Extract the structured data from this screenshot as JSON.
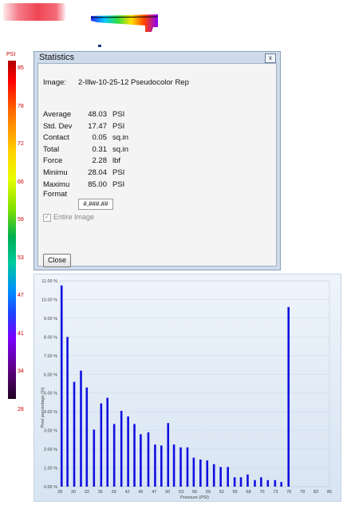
{
  "thumbnails": {
    "left_icon": "pressure-footprint-red-thumbnail",
    "right_icon": "pressure-footprint-pseudocolor-thumbnail"
  },
  "color_scale": {
    "unit": "PSI",
    "ticks": [
      "85",
      "78",
      "72",
      "66",
      "59",
      "53",
      "47",
      "41",
      "34",
      "28"
    ]
  },
  "statistics": {
    "title": "Statistics",
    "close_glyph": "x",
    "image_label": "Image:",
    "image_name": "2-Illw-10-25-12 Pseudocolor Rep",
    "rows": [
      {
        "label": "Average",
        "value": "48.03",
        "unit": "PSI"
      },
      {
        "label": "Std. Dev",
        "value": "17.47",
        "unit": "PSI"
      },
      {
        "label": "Contact",
        "value": "0.05",
        "unit": "sq.in"
      },
      {
        "label": "Total",
        "value": "0.31",
        "unit": "sq.in"
      },
      {
        "label": "Force",
        "value": "2.28",
        "unit": "lbf"
      },
      {
        "label": "Minimu",
        "value": "28.04",
        "unit": "PSI"
      },
      {
        "label": "Maximu",
        "value": "85.00",
        "unit": "PSI"
      }
    ],
    "format_label": "Format",
    "format_value": "#,###.##",
    "entire_image_label": "Entire Image",
    "entire_image_checked": true,
    "close_button": "Close"
  },
  "chart_data": {
    "type": "bar",
    "color": "#1010e0",
    "xlabel": "Pressure (PSI)",
    "ylabel": "Pixel percentage (%)",
    "xlim": [
      28,
      88
    ],
    "ylim": [
      0,
      11
    ],
    "x_ticks": [
      "28",
      "30",
      "33",
      "36",
      "39",
      "42",
      "45",
      "47",
      "50",
      "53",
      "56",
      "59",
      "62",
      "65",
      "68",
      "70",
      "73",
      "76",
      "79",
      "82",
      "85"
    ],
    "y_ticks": [
      "0.00 %",
      "1.00 %",
      "2.00 %",
      "3.00 %",
      "4.00 %",
      "5.00 %",
      "6.00 %",
      "7.00 %",
      "8.00 %",
      "9.00 %",
      "10.00 %",
      "11.00 %"
    ],
    "x": [
      28.4,
      29.7,
      31.2,
      32.7,
      34.0,
      35.6,
      37.2,
      38.6,
      40.1,
      41.7,
      43.2,
      44.6,
      46.0,
      47.7,
      49.2,
      50.6,
      52.1,
      53.4,
      54.9,
      56.4,
      57.8,
      59.3,
      60.8,
      62.3,
      63.8,
      65.4,
      66.9,
      68.3,
      69.8,
      71.4,
      72.8,
      74.3,
      75.9,
      77.3,
      78.9,
      80.4,
      81.9,
      83.5
    ],
    "values": [
      10.75,
      8.0,
      5.6,
      6.2,
      5.3,
      3.05,
      4.45,
      4.75,
      3.35,
      4.05,
      3.75,
      3.35,
      2.8,
      2.9,
      2.25,
      2.2,
      3.4,
      2.25,
      2.1,
      2.1,
      1.55,
      1.45,
      1.4,
      1.2,
      1.05,
      1.05,
      0.5,
      0.5,
      0.65,
      0.35,
      0.5,
      0.35,
      0.35,
      0.25,
      9.6,
      0,
      0,
      0
    ]
  }
}
